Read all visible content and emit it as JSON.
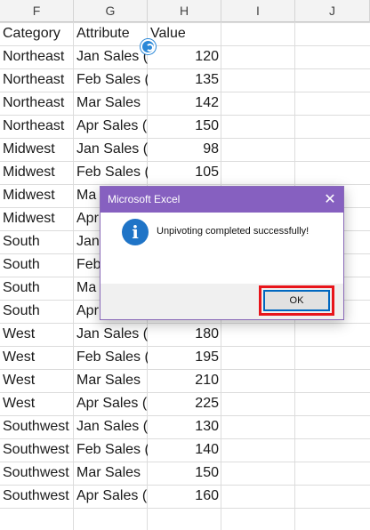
{
  "columns": [
    "F",
    "G",
    "H",
    "I",
    "J"
  ],
  "header_row": {
    "category": "Category",
    "attribute": "Attribute",
    "value": "Value"
  },
  "rows": [
    {
      "category": "Northeast",
      "attribute": "Jan Sales (",
      "value": "120"
    },
    {
      "category": "Northeast",
      "attribute": "Feb Sales (",
      "value": "135"
    },
    {
      "category": "Northeast",
      "attribute": "Mar Sales",
      "value": "142"
    },
    {
      "category": "Northeast",
      "attribute": "Apr Sales (",
      "value": "150"
    },
    {
      "category": "Midwest",
      "attribute": "Jan Sales (",
      "value": "98"
    },
    {
      "category": "Midwest",
      "attribute": "Feb Sales (",
      "value": "105"
    },
    {
      "category": "Midwest",
      "attribute": "Ma",
      "value": ""
    },
    {
      "category": "Midwest",
      "attribute": "Apr",
      "value": ""
    },
    {
      "category": "South",
      "attribute": "Jan",
      "value": ""
    },
    {
      "category": "South",
      "attribute": "Feb",
      "value": ""
    },
    {
      "category": "South",
      "attribute": "Ma",
      "value": ""
    },
    {
      "category": "South",
      "attribute": "Apr",
      "value": ""
    },
    {
      "category": "West",
      "attribute": "Jan Sales (",
      "value": "180"
    },
    {
      "category": "West",
      "attribute": "Feb Sales (",
      "value": "195"
    },
    {
      "category": "West",
      "attribute": "Mar Sales",
      "value": "210"
    },
    {
      "category": "West",
      "attribute": "Apr Sales (",
      "value": "225"
    },
    {
      "category": "Southwest",
      "attribute": "Jan Sales (",
      "value": "130"
    },
    {
      "category": "Southwest",
      "attribute": "Feb Sales (",
      "value": "140"
    },
    {
      "category": "Southwest",
      "attribute": "Mar Sales",
      "value": "150"
    },
    {
      "category": "Southwest",
      "attribute": "Apr Sales (",
      "value": "160"
    }
  ],
  "dialog": {
    "title": "Microsoft Excel",
    "close_glyph": "✕",
    "icon_glyph": "i",
    "message": "Unpivoting completed successfully!",
    "ok_label": "OK",
    "highlight_color": "#e8151b",
    "titlebar_color": "#8660c0"
  },
  "cursor": {
    "icon": "loading-cursor-icon"
  }
}
